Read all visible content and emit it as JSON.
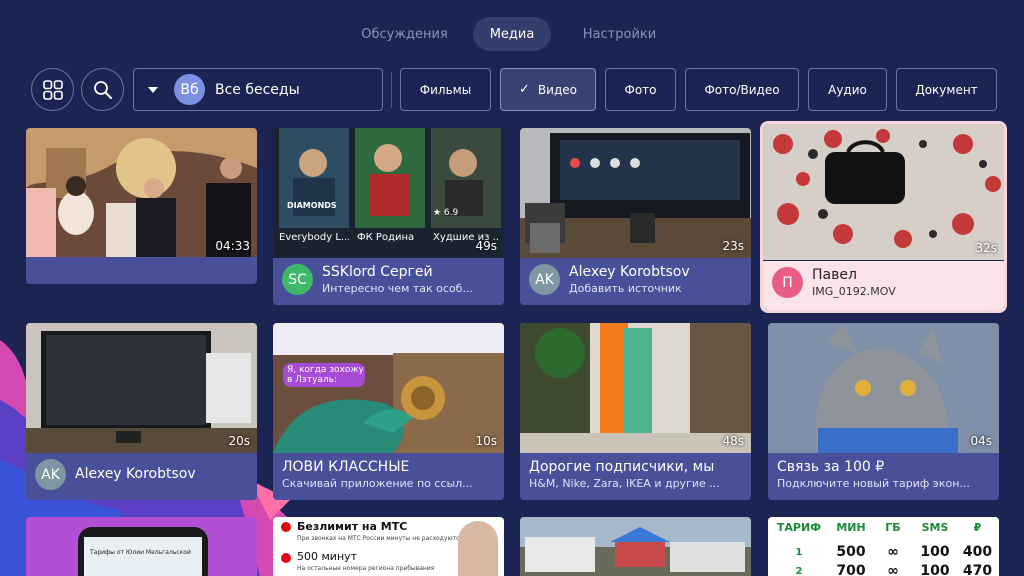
{
  "tabs": [
    {
      "label": "Обсуждения",
      "active": false
    },
    {
      "label": "Медиа",
      "active": true
    },
    {
      "label": "Настройки",
      "active": false
    }
  ],
  "toolbar": {
    "chat_filter": {
      "avatar_initials": "Вб",
      "label": "Все беседы"
    },
    "chips": [
      {
        "label": "Фильмы",
        "selected": false
      },
      {
        "label": "Видео",
        "selected": true,
        "check_glyph": "✓"
      },
      {
        "label": "Фото",
        "selected": false
      },
      {
        "label": "Фото/Видео",
        "selected": false
      },
      {
        "label": "Аудио",
        "selected": false
      },
      {
        "label": "Документ",
        "selected": false
      }
    ]
  },
  "media": [
    {
      "duration": "04:33",
      "author": "",
      "caption": "",
      "initials": ""
    },
    {
      "duration": "49s",
      "author": "SSKlord Сергей",
      "caption": "Интересно чем так особ...",
      "initials": "SC",
      "avatar_color": "#3fb86a"
    },
    {
      "duration": "23s",
      "author": "Alexey Korobtsov",
      "caption": "Добавить источник",
      "initials": "AK",
      "avatar_color": "#7f96a3"
    },
    {
      "duration": "32s",
      "author": "Павел",
      "caption": "IMG_0192.MOV",
      "initials": "П",
      "avatar_color": "#e85c86",
      "focused": true
    },
    {
      "duration": "20s",
      "author": "Alexey Korobtsov",
      "caption": "",
      "initials": "AK",
      "avatar_color": "#7f96a3"
    },
    {
      "duration": "10s",
      "author": "ЛОВИ КЛАССНЫЕ",
      "caption": "Скачивай приложение по ссыл...",
      "initials": ""
    },
    {
      "duration": "48s",
      "author": "Дорогие подписчики, мы",
      "caption": "H&M, Nike, Zara, IKEA и другие ...",
      "initials": ""
    },
    {
      "duration": "04s",
      "author": "Связь за 100 ₽",
      "caption": "Подключите новый тариф экон...",
      "initials": ""
    }
  ],
  "thumb_texts": {
    "t2_labels": [
      "Everybody L...",
      "ФК Родина",
      "Худшие из ..."
    ],
    "t2_rating": "★ 6.9",
    "t2_poster_title": "DIAMONDS",
    "t6_bubble": "Я, когда зохожу в Лэтуаль:",
    "t9_title": "Тарифы от Юлии Мельгальской",
    "t10_title": "Безлимит на МТС",
    "t10_sub": "При звонках на МТС России минуты не расходуются",
    "t10_minutes": "500 минут",
    "t10_minutes_sub": "На остальные номера региона пребывания",
    "t12_headers": [
      "ТАРИФ",
      "МИН",
      "ГБ",
      "SMS",
      "₽"
    ],
    "t12_rows": [
      [
        "1",
        "500",
        "∞",
        "100",
        "400"
      ],
      [
        "2",
        "700",
        "∞",
        "100",
        "470"
      ]
    ]
  },
  "colors": {
    "background": "#1c2454",
    "card_info": "#4a4f9a",
    "focus": "#fbe4e9"
  }
}
